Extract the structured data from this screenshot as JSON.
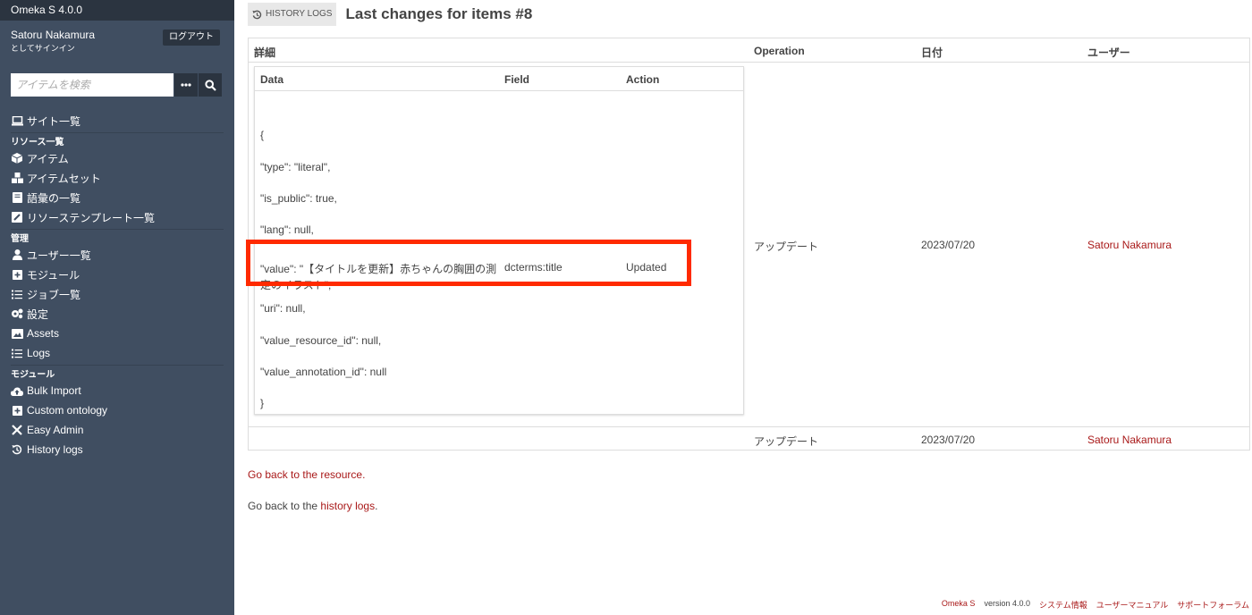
{
  "app": {
    "title": "Omeka S 4.0.0"
  },
  "user": {
    "name": "Satoru Nakamura",
    "signed_in_as": "としてサインイン",
    "logout_label": "ログアウト"
  },
  "search": {
    "placeholder": "アイテムを検索"
  },
  "nav": {
    "sites": "サイト一覧",
    "resources_heading": "リソース一覧",
    "items": "アイテム",
    "item_sets": "アイテムセット",
    "vocabularies": "語彙の一覧",
    "resource_templates": "リソーステンプレート一覧",
    "admin_heading": "管理",
    "users": "ユーザー一覧",
    "modules": "モジュール",
    "jobs": "ジョブ一覧",
    "settings": "設定",
    "assets": "Assets",
    "logs": "Logs",
    "modules_heading": "モジュール",
    "bulk_import": "Bulk Import",
    "custom_ontology": "Custom ontology",
    "easy_admin": "Easy Admin",
    "history_logs": "History logs"
  },
  "header": {
    "badge": "HISTORY LOGS",
    "title": "Last changes for items #8"
  },
  "table": {
    "col_details": "詳細",
    "col_operation": "Operation",
    "col_date": "日付",
    "col_user": "ユーザー",
    "rows": [
      {
        "operation": "アップデート",
        "date": "2023/07/20",
        "user": "Satoru Nakamura"
      },
      {
        "operation": "アップデート",
        "date": "2023/07/20",
        "user": "Satoru Nakamura"
      }
    ],
    "inner": {
      "col_data": "Data",
      "col_field": "Field",
      "col_action": "Action",
      "lines": [
        "{",
        "\"type\": \"literal\",",
        "\"is_public\": true,",
        "\"lang\": null,",
        "\"uri\": null,",
        "\"value_resource_id\": null,",
        "\"value_annotation_id\": null",
        "}"
      ],
      "value_line": "\"value\": \"【タイトルを更新】赤ちゃんの胸囲の測定のイラスト\",",
      "field": "dcterms:title",
      "action": "Updated"
    }
  },
  "links": {
    "back_resource": "Go back to the resource.",
    "back_history_prefix": "Go back to the ",
    "back_history_link": "history logs",
    "back_history_suffix": "."
  },
  "footer": {
    "omeka": "Omeka S",
    "version": "version 4.0.0",
    "system_info": "システム情報",
    "user_manual": "ユーザーマニュアル",
    "support_forum": "サポートフォーラム"
  },
  "colors": {
    "sidebar": "#404e61",
    "sidebar_dark": "#2b3440",
    "link": "#a91919",
    "highlight": "#ff2a00"
  }
}
